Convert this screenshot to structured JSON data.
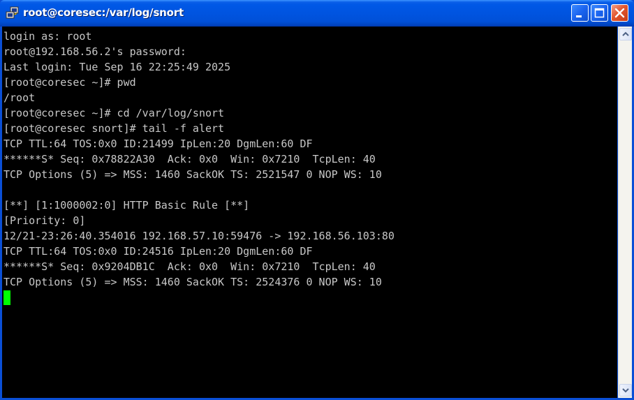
{
  "window": {
    "title": "root@coresec:/var/log/snort"
  },
  "terminal": {
    "lines": [
      "login as: root",
      "root@192.168.56.2's password:",
      "Last login: Tue Sep 16 22:25:49 2025",
      "[root@coresec ~]# pwd",
      "/root",
      "[root@coresec ~]# cd /var/log/snort",
      "[root@coresec snort]# tail -f alert",
      "TCP TTL:64 TOS:0x0 ID:21499 IpLen:20 DgmLen:60 DF",
      "******S* Seq: 0x78822A30  Ack: 0x0  Win: 0x7210  TcpLen: 40",
      "TCP Options (5) => MSS: 1460 SackOK TS: 2521547 0 NOP WS: 10",
      "",
      "[**] [1:1000002:0] HTTP Basic Rule [**]",
      "[Priority: 0]",
      "12/21-23:26:40.354016 192.168.57.10:59476 -> 192.168.56.103:80",
      "TCP TTL:64 TOS:0x0 ID:24516 IpLen:20 DgmLen:60 DF",
      "******S* Seq: 0x9204DB1C  Ack: 0x0  Win: 0x7210  TcpLen: 40",
      "TCP Options (5) => MSS: 1460 SackOK TS: 2524376 0 NOP WS: 10"
    ]
  },
  "icons": {
    "window": "putty-icon",
    "minimize": "minimize-icon",
    "maximize": "maximize-icon",
    "close": "close-icon",
    "scroll_up": "scroll-up-arrow-icon",
    "scroll_down": "scroll-down-arrow-icon"
  },
  "colors": {
    "titlebar": "#0054e0",
    "terminal_bg": "#000000",
    "terminal_fg": "#c8c8c8",
    "cursor": "#00ff00",
    "close_button": "#e2572f"
  }
}
